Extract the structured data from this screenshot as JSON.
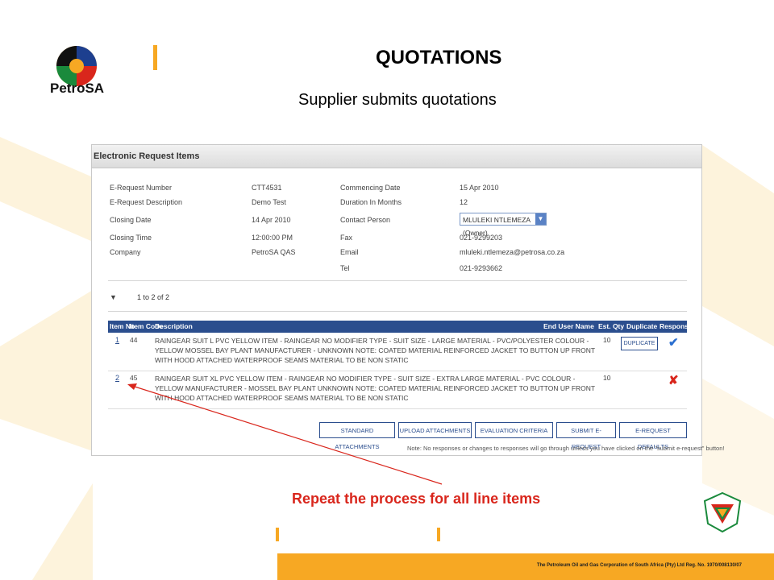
{
  "slide": {
    "title": "QUOTATIONS",
    "subtitle": "Supplier submits quotations",
    "logo_text": "PetroSA",
    "callout": "Repeat the process for all line items",
    "footer": "The Petroleum Oil and Gas Corporation of South Africa (Pty) Ltd  Reg. No. 1970/008130/07"
  },
  "screenshot": {
    "header": "Electronic Request Items",
    "info_left": [
      {
        "label": "E-Request Number",
        "value": "CTT4531"
      },
      {
        "label": "E-Request Description",
        "value": "Demo Test"
      },
      {
        "label": "Closing Date",
        "value": "14 Apr 2010"
      },
      {
        "label": "Closing Time",
        "value": "12:00:00 PM"
      },
      {
        "label": "Company",
        "value": "PetroSA QAS"
      }
    ],
    "info_right": [
      {
        "label": "Commencing Date",
        "value": "15 Apr 2010"
      },
      {
        "label": "Duration In Months",
        "value": "12"
      },
      {
        "label": "Contact Person",
        "value": "MLULEKI NTLEMEZA (Owner)"
      },
      {
        "label": "Fax",
        "value": "021-9299203"
      },
      {
        "label": "Email",
        "value": "mluleki.ntlemeza@petrosa.co.za"
      },
      {
        "label": "Tel",
        "value": "021-9293662"
      }
    ],
    "pager": "1 to 2 of 2",
    "columns": [
      "Item No",
      "Item Code",
      "Description",
      "End User Name",
      "Est. Qty",
      "Duplicate",
      "Response"
    ],
    "rows": [
      {
        "no": "1",
        "code": "44",
        "desc": "RAINGEAR SUIT L PVC YELLOW ITEM - RAINGEAR NO MODIFIER TYPE - SUIT SIZE - LARGE MATERIAL - PVC/POLYESTER COLOUR - YELLOW MOSSEL BAY PLANT MANUFACTURER - UNKNOWN NOTE: COATED MATERIAL REINFORCED JACKET TO BUTTON UP FRONT WITH HOOD ATTACHED WATERPROOF SEAMS MATERIAL TO BE NON STATIC",
        "qty": "10",
        "duplicate": "DUPLICATE",
        "response": "✔"
      },
      {
        "no": "2",
        "code": "45",
        "desc": "RAINGEAR SUIT XL PVC YELLOW ITEM - RAINGEAR NO MODIFIER TYPE - SUIT SIZE - EXTRA LARGE MATERIAL - PVC COLOUR - YELLOW MANUFACTURER - MOSSEL BAY PLANT UNKNOWN NOTE: COATED MATERIAL REINFORCED JACKET TO BUTTON UP FRONT WITH HOOD ATTACHED WATERPROOF SEAMS MATERIAL TO BE NON STATIC",
        "qty": "10",
        "duplicate": "",
        "response": "✘"
      }
    ],
    "buttons": [
      "STANDARD ATTACHMENTS",
      "UPLOAD ATTACHMENTS",
      "EVALUATION CRITERIA",
      "SUBMIT E-REQUEST",
      "E-REQUEST DEFAULTS"
    ],
    "note": "Note:  No responses or changes to responses will go through unless you have clicked on the \"submit e-request\" button!"
  },
  "colors": {
    "accent_orange": "#f7a823",
    "grid_header": "#2b4e8e",
    "callout_red": "#d9261c"
  }
}
